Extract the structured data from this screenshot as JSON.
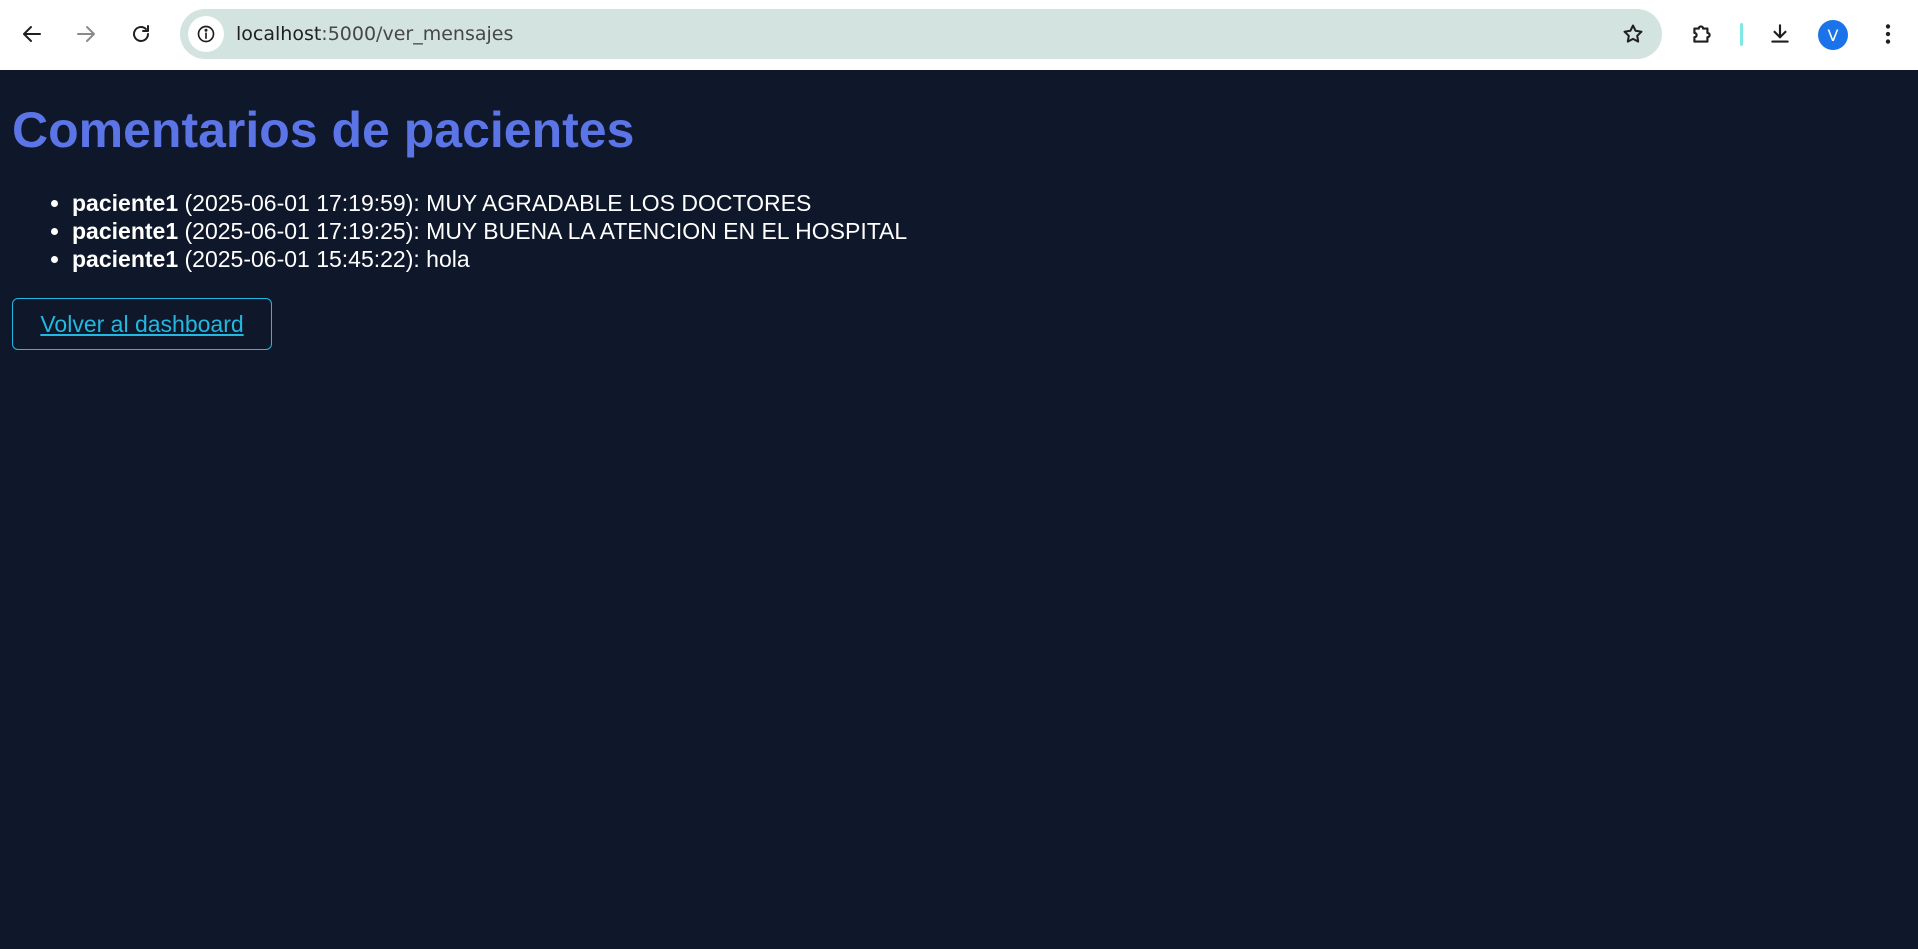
{
  "browser": {
    "url_host": "localhost",
    "url_path": ":5000/ver_mensajes",
    "profile_initial": "V",
    "icons": {
      "back": "arrow-left-icon",
      "forward": "arrow-right-icon",
      "reload": "reload-icon",
      "site_info": "info-icon",
      "bookmark": "star-icon",
      "extensions": "puzzle-icon",
      "downloads": "download-icon",
      "menu": "kebab-menu-icon"
    },
    "colors": {
      "omnibox": "#d3e3e0",
      "avatar": "#1a73e8"
    }
  },
  "page": {
    "title": "Comentarios de pacientes",
    "messages": [
      {
        "user": "paciente1",
        "meta": " (2025-06-01 17:19:59): MUY AGRADABLE LOS DOCTORES"
      },
      {
        "user": "paciente1",
        "meta": " (2025-06-01 17:19:25): MUY BUENA LA ATENCION EN EL HOSPITAL"
      },
      {
        "user": "paciente1",
        "meta": " (2025-06-01 15:45:22): hola"
      }
    ],
    "back_link": "Volver al dashboard",
    "colors": {
      "background": "#0f172a",
      "title": "#5b74e6",
      "text": "#ffffff",
      "link": "#22b8e0"
    }
  }
}
